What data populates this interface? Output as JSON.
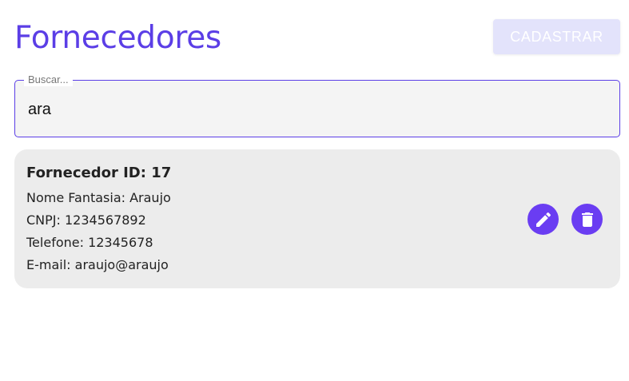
{
  "header": {
    "title": "Fornecedores",
    "register_label": "CADASTRAR"
  },
  "search": {
    "label": "Buscar...",
    "value": "ara"
  },
  "suppliers": [
    {
      "title": "Fornecedor ID: 17",
      "trade_name": "Nome Fantasia: Araujo",
      "cnpj": "CNPJ: 1234567892",
      "phone": "Telefone: 12345678",
      "email": "E-mail: araujo@araujo",
      "icons": {
        "edit": "pencil-icon",
        "delete": "trash-icon"
      }
    }
  ],
  "colors": {
    "accent": "#6a3df2",
    "title": "#5b3ee6",
    "register_button_bg": "#e3e3fb",
    "card_bg": "#ececec",
    "search_bg": "#f4f4f4"
  }
}
